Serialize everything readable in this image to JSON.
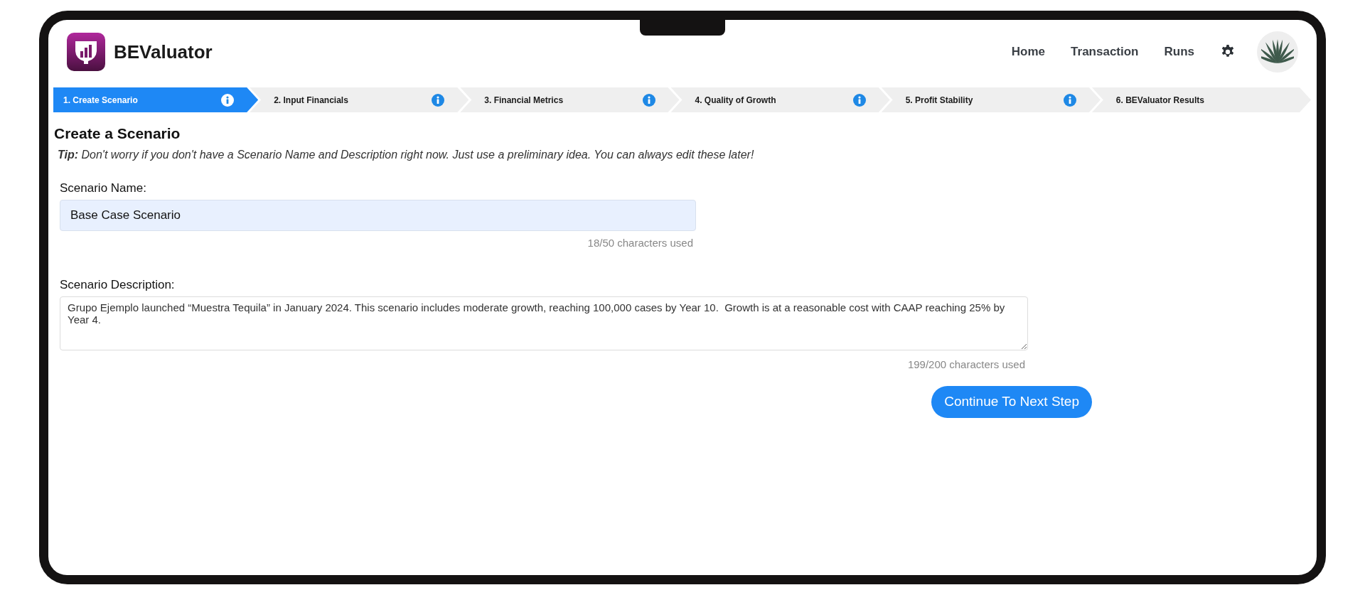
{
  "app": {
    "name": "BEValuator"
  },
  "nav": [
    {
      "label": "Home"
    },
    {
      "label": "Transaction"
    },
    {
      "label": "Runs"
    }
  ],
  "steps": [
    {
      "label": "1. Create Scenario",
      "selected": true,
      "info": true
    },
    {
      "label": "2. Input Financials",
      "selected": false,
      "info": true
    },
    {
      "label": "3. Financial Metrics",
      "selected": false,
      "info": true
    },
    {
      "label": "4. Quality of Growth",
      "selected": false,
      "info": true
    },
    {
      "label": "5. Profit Stability",
      "selected": false,
      "info": true
    },
    {
      "label": "6. BEValuator Results",
      "selected": false,
      "info": false
    }
  ],
  "page": {
    "title": "Create a Scenario",
    "tip": "**Tip:** Don't worry if you don't have a Scenario Name and Description right now. Just use a preliminary idea. You can always edit these later!"
  },
  "name_field": {
    "label": "Scenario Name:",
    "value": "Base Case Scenario",
    "counter": "18/50 characters used"
  },
  "description_field": {
    "label": "Scenario Description:",
    "value": "Grupo Ejemplo launched “Muestra Tequila” in January 2024. This scenario includes moderate growth, reaching 100,000 cases by Year 10.  Growth is at a reasonable cost with CAAP reaching 25% by Year 4.",
    "counter": "199/200 characters used"
  },
  "continue_button": {
    "label": "Continue To Next Step"
  }
}
